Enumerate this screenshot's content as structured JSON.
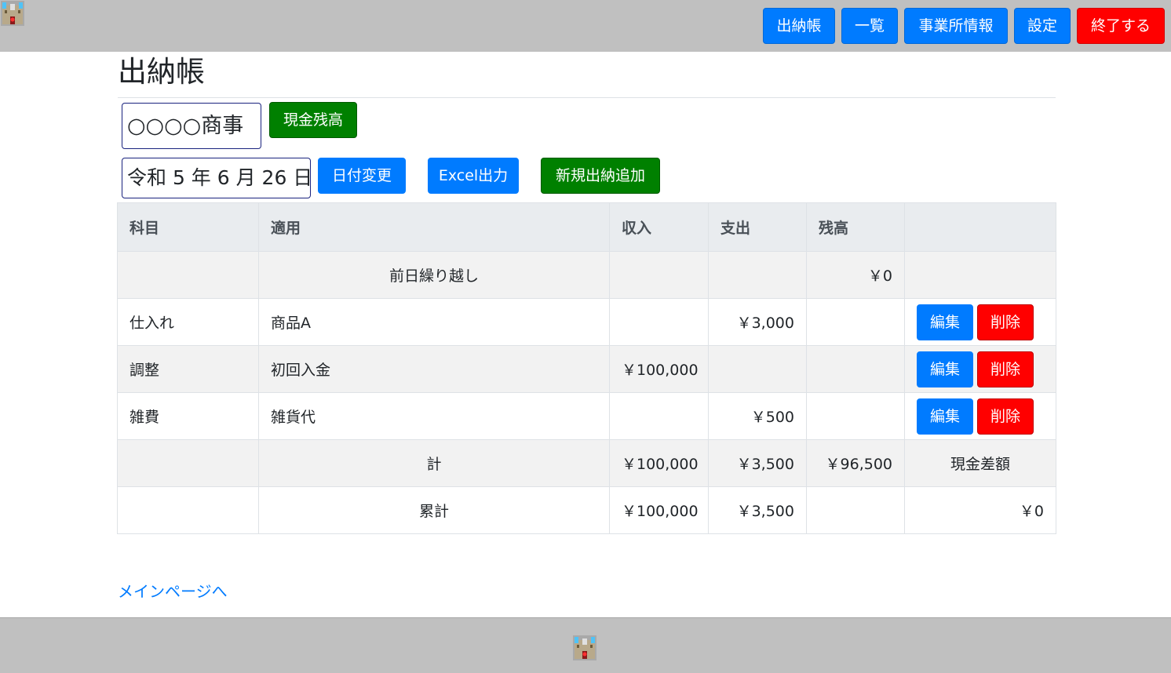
{
  "header": {
    "nav": [
      {
        "label": "出納帳"
      },
      {
        "label": "一覧"
      },
      {
        "label": "事業所情報"
      },
      {
        "label": "設定"
      },
      {
        "label": "終了する"
      }
    ]
  },
  "page": {
    "title": "出納帳",
    "company_name": "○○○○商事",
    "cash_balance_button": "現金残高",
    "date_value": "令和 5 年 6 月 26 日",
    "change_date_button": "日付変更",
    "excel_button": "Excel出力",
    "new_entry_button": "新規出納追加",
    "back_link": "メインページへ"
  },
  "colors": {
    "primary": "#007bff",
    "success": "#008000",
    "danger": "#ff0000",
    "chrome": "#c0c0c0"
  },
  "icons": [
    "castle-logo-icon"
  ],
  "table": {
    "headers": [
      "科目",
      "適用",
      "収入",
      "支出",
      "残高",
      ""
    ],
    "carry": {
      "summary": "前日繰り越し",
      "balance": "￥0"
    },
    "rows": [
      {
        "account": "仕入れ",
        "summary": "商品A",
        "income": "",
        "expense": "￥3,000",
        "balance": ""
      },
      {
        "account": "調整",
        "summary": "初回入金",
        "income": "￥100,000",
        "expense": "",
        "balance": ""
      },
      {
        "account": "雑費",
        "summary": "雑貨代",
        "income": "",
        "expense": "￥500",
        "balance": ""
      }
    ],
    "edit_label": "編集",
    "delete_label": "削除",
    "total": {
      "label": "計",
      "income": "￥100,000",
      "expense": "￥3,500",
      "balance": "￥96,500",
      "diff_label": "現金差額"
    },
    "cumulative": {
      "label": "累計",
      "income": "￥100,000",
      "expense": "￥3,500",
      "diff": "￥0"
    }
  }
}
